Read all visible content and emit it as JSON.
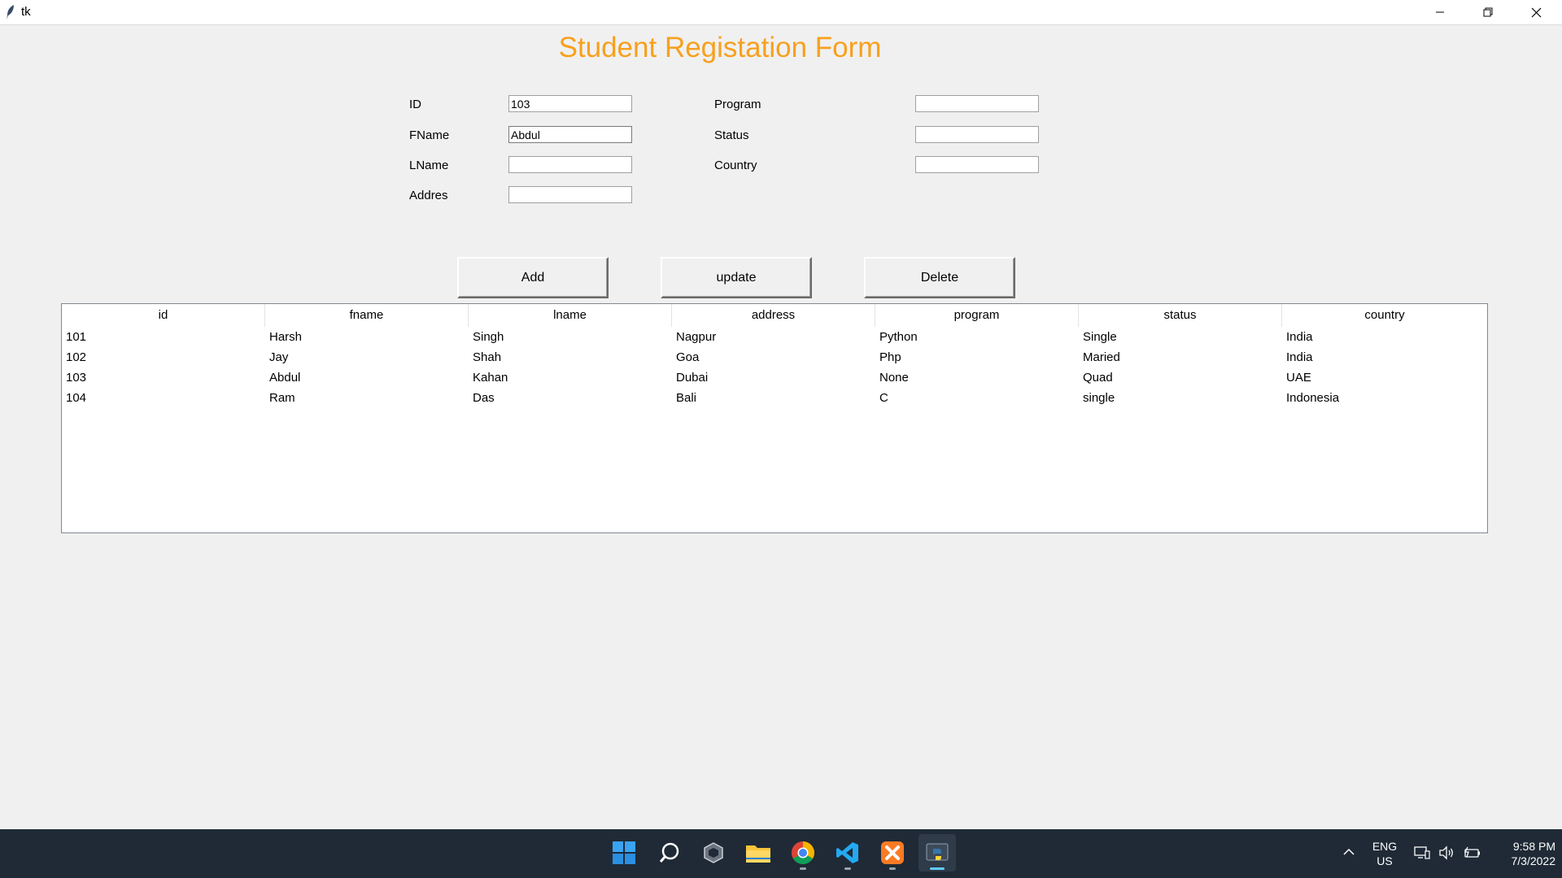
{
  "window": {
    "title": "tk"
  },
  "form": {
    "heading": "Student Registation Form",
    "fields": {
      "id": {
        "label": "ID",
        "value": "103"
      },
      "fname": {
        "label": "FName",
        "value": "Abdul"
      },
      "lname": {
        "label": "LName",
        "value": ""
      },
      "address": {
        "label": "Addres",
        "value": ""
      },
      "program": {
        "label": "Program",
        "value": ""
      },
      "status": {
        "label": "Status",
        "value": ""
      },
      "country": {
        "label": "Country",
        "value": ""
      }
    }
  },
  "buttons": {
    "add": "Add",
    "update": "update",
    "delete": "Delete"
  },
  "table": {
    "columns": [
      "id",
      "fname",
      "lname",
      "address",
      "program",
      "status",
      "country"
    ],
    "rows": [
      [
        "101",
        "Harsh",
        "Singh",
        "Nagpur",
        "Python",
        "Single",
        "India"
      ],
      [
        "102",
        "Jay",
        "Shah",
        "Goa",
        "Php",
        "Maried",
        "India"
      ],
      [
        "103",
        "Abdul",
        "Kahan",
        "Dubai",
        "None",
        "Quad",
        "UAE"
      ],
      [
        "104",
        "Ram",
        "Das",
        "Bali",
        "C",
        "single",
        "Indonesia"
      ]
    ]
  },
  "taskbar": {
    "apps": [
      "start-icon",
      "search-icon",
      "unity-icon",
      "file-explorer-icon",
      "chrome-icon",
      "vscode-icon",
      "xampp-icon",
      "python-icon"
    ],
    "language": {
      "line1": "ENG",
      "line2": "US"
    },
    "clock": {
      "time": "9:58 PM",
      "date": "7/3/2022"
    }
  },
  "colors": {
    "heading": "#f7a01d",
    "taskbar": "#1f2a36"
  }
}
